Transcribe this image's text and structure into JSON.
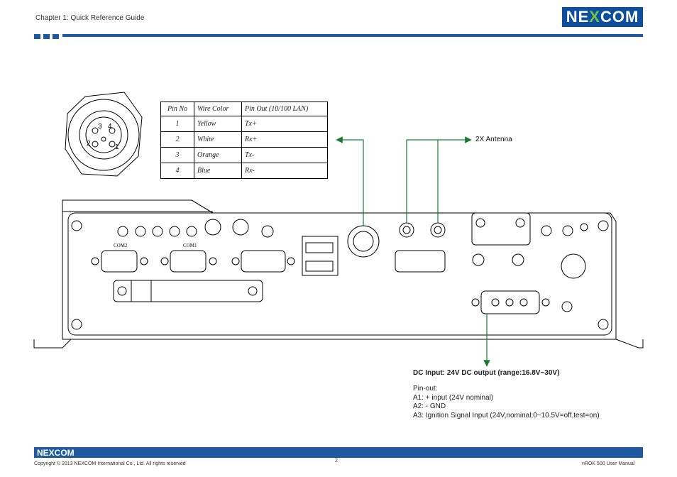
{
  "header": {
    "chapter": "Chapter 1: Quick Reference Guide",
    "logo": "NEXCOM"
  },
  "pin_table": {
    "headers": [
      "Pin No",
      "Wire Color",
      "Pin Out (10/100 LAN)"
    ],
    "rows": [
      [
        "1",
        "Yellow",
        "Tx+"
      ],
      [
        "2",
        "White",
        "Rx+"
      ],
      [
        "3",
        "Orange",
        "Tx-"
      ],
      [
        "4",
        "Blue",
        "Rx-"
      ]
    ]
  },
  "connector_pins": [
    "3",
    "4",
    "2",
    "1"
  ],
  "panel_labels": {
    "com2": "COM2",
    "com1": "COM1"
  },
  "antenna_label": "2X Antenna",
  "dc": {
    "title": "DC Input: 24V DC output (range:16.8V~30V)",
    "pinout_title": "Pin-out:",
    "lines": [
      "A1: + input (24V nominal)",
      "A2: - GND",
      "A3: Ignition Signal Input (24V,nominal;0~10.5V=off,test=on)"
    ]
  },
  "footer": {
    "logo": "NEXCOM",
    "copyright": "Copyright © 2013 NEXCOM International Co., Ltd. All rights reserved",
    "page": "2",
    "manual": "nROK 500 User Manual"
  },
  "colors": {
    "brand_blue": "#1f5aa0",
    "arrow_green": "#1a7a2e"
  }
}
